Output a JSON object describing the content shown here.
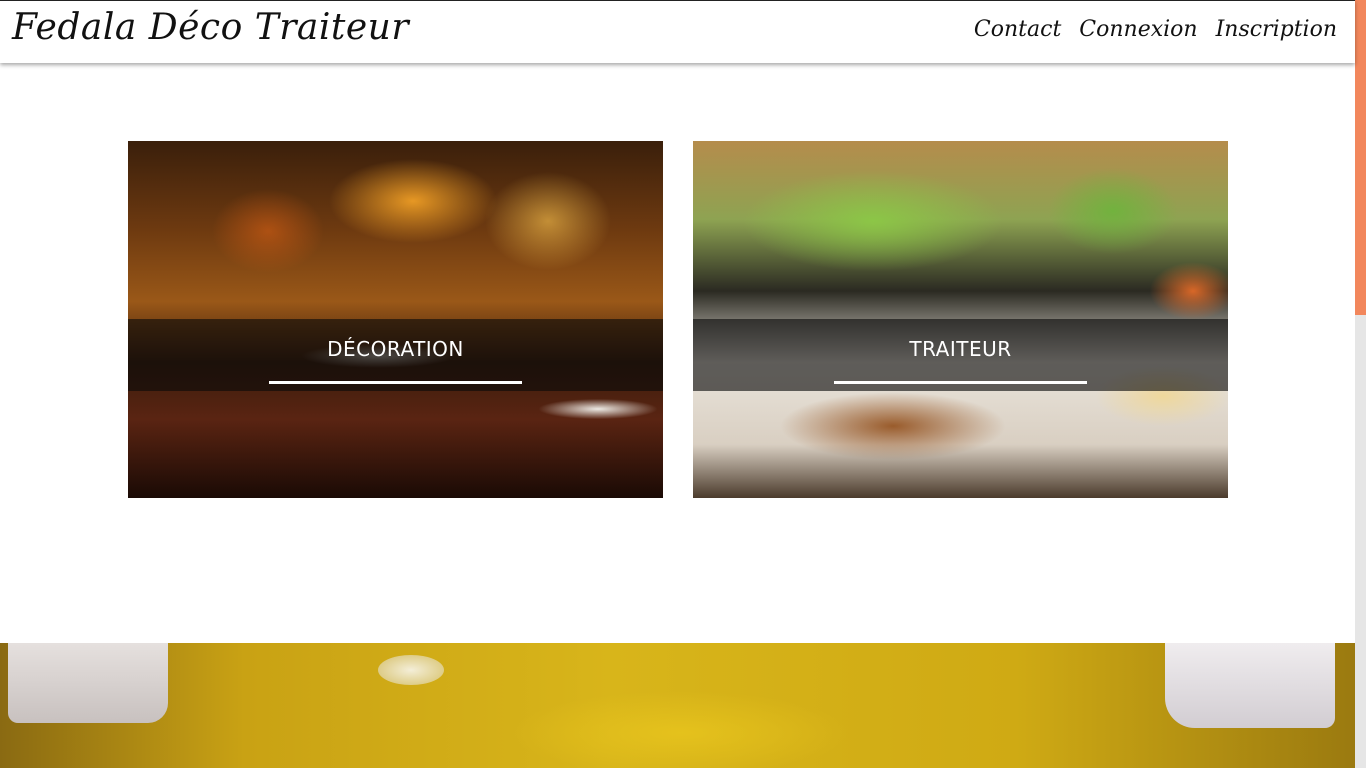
{
  "brand": {
    "name": "Fedala Déco Traiteur"
  },
  "nav": {
    "links": [
      {
        "label": "Contact"
      },
      {
        "label": "Connexion"
      },
      {
        "label": "Inscription"
      }
    ]
  },
  "services": [
    {
      "title": "DÉCORATION"
    },
    {
      "title": "TRAITEUR"
    }
  ],
  "colors": {
    "scrollbar_thumb": "#f2875c",
    "overlay": "rgba(10,10,10,0.62)",
    "title_text": "#ffffff"
  }
}
